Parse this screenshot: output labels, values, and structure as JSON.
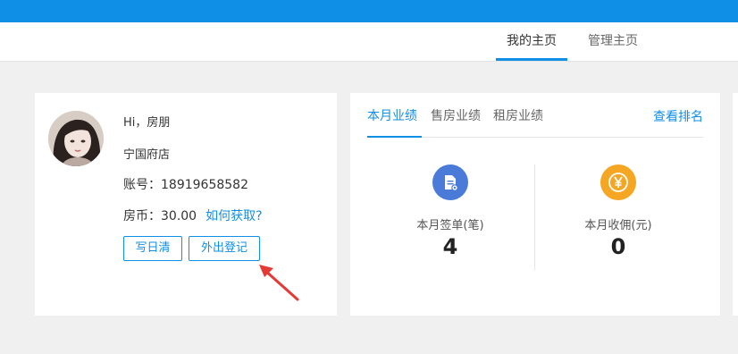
{
  "nav": {
    "tabs": [
      {
        "label": "我的主页",
        "active": true
      },
      {
        "label": "管理主页",
        "active": false
      }
    ]
  },
  "profile": {
    "greeting": "Hi，房朋",
    "store": "宁国府店",
    "account_label": "账号：",
    "account": "18919658582",
    "coin_label": "房币：",
    "coin": "30.00",
    "coin_help": "如何获取?",
    "buttons": {
      "diary": "写日清",
      "out": "外出登记"
    }
  },
  "performance": {
    "tabs": [
      {
        "label": "本月业绩",
        "active": true
      },
      {
        "label": "售房业绩",
        "active": false
      },
      {
        "label": "租房业绩",
        "active": false
      }
    ],
    "rank_link": "查看排名",
    "stats": [
      {
        "label": "本月签单(笔)",
        "value": "4",
        "icon": "document-icon",
        "color": "#4a7bd9"
      },
      {
        "label": "本月收佣(元)",
        "value": "0",
        "icon": "yen-icon",
        "color": "#f5a623"
      }
    ]
  },
  "colors": {
    "accent": "#0f8fe6",
    "annotation_arrow": "#e53935"
  }
}
